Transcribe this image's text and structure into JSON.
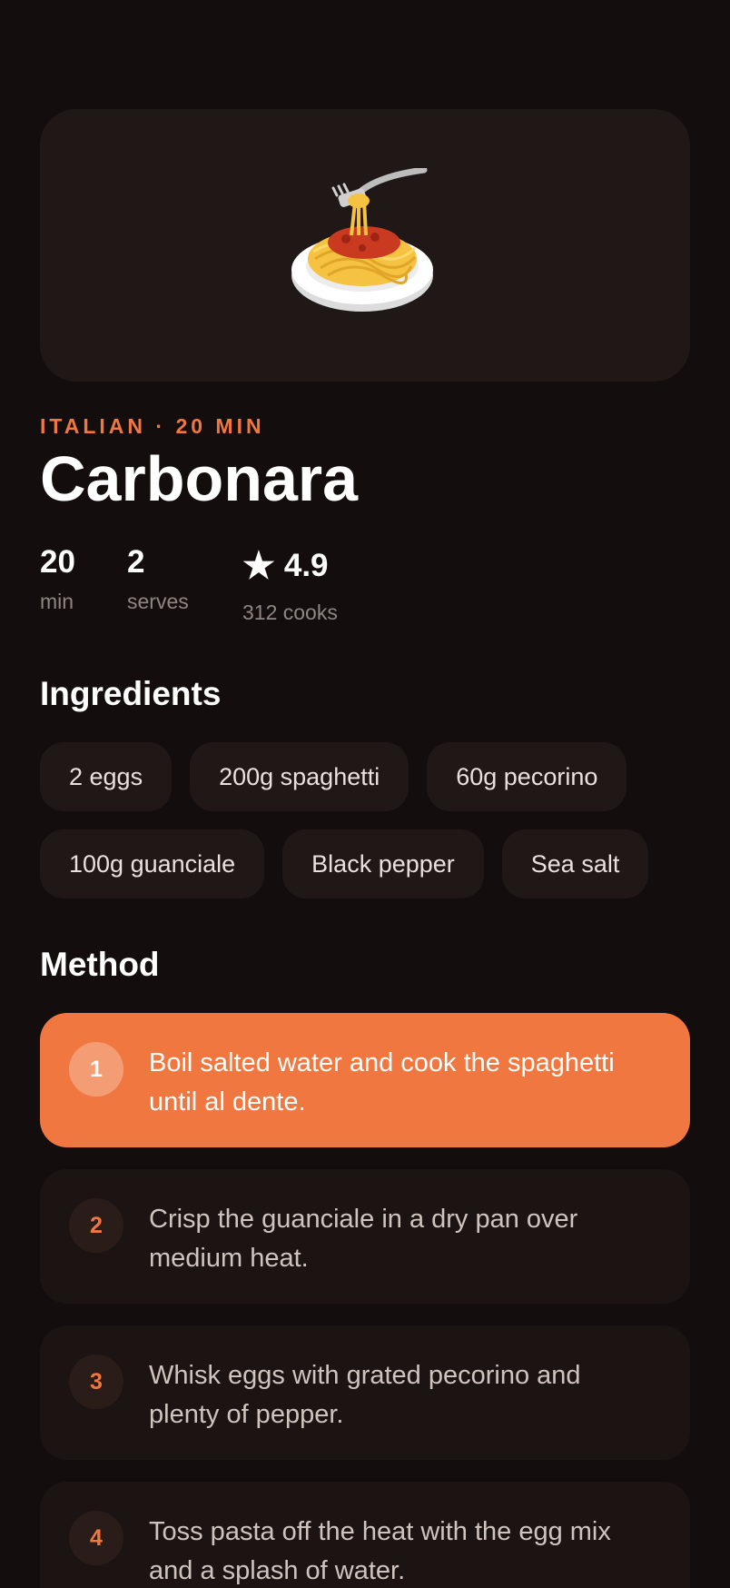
{
  "hero": {
    "icon": "spaghetti-plate-icon"
  },
  "recipe": {
    "meta": "ITALIAN · 20 MIN",
    "title": "Carbonara"
  },
  "stats": {
    "time": {
      "value": "20",
      "label": "min"
    },
    "serves": {
      "value": "2",
      "label": "serves"
    },
    "rating": {
      "icon": "star-icon",
      "star": "★",
      "value": "4.9",
      "label": "312 cooks"
    }
  },
  "ingredients": {
    "title": "Ingredients",
    "items": [
      "2 eggs",
      "200g spaghetti",
      "60g pecorino",
      "100g guanciale",
      "Black pepper",
      "Sea salt"
    ]
  },
  "method": {
    "title": "Method",
    "steps": [
      {
        "number": "1",
        "text": "Boil salted water and cook the spaghetti until al dente.",
        "active": true
      },
      {
        "number": "2",
        "text": "Crisp the guanciale in a dry pan over medium heat.",
        "active": false
      },
      {
        "number": "3",
        "text": "Whisk eggs with grated pecorino and plenty of pepper.",
        "active": false
      },
      {
        "number": "4",
        "text": "Toss pasta off the heat with the egg mix and a splash of water.",
        "active": false
      }
    ]
  },
  "colors": {
    "background": "#130e0d",
    "card": "#1f1816",
    "accent": "#f07840",
    "muted_text": "#8f8682"
  }
}
